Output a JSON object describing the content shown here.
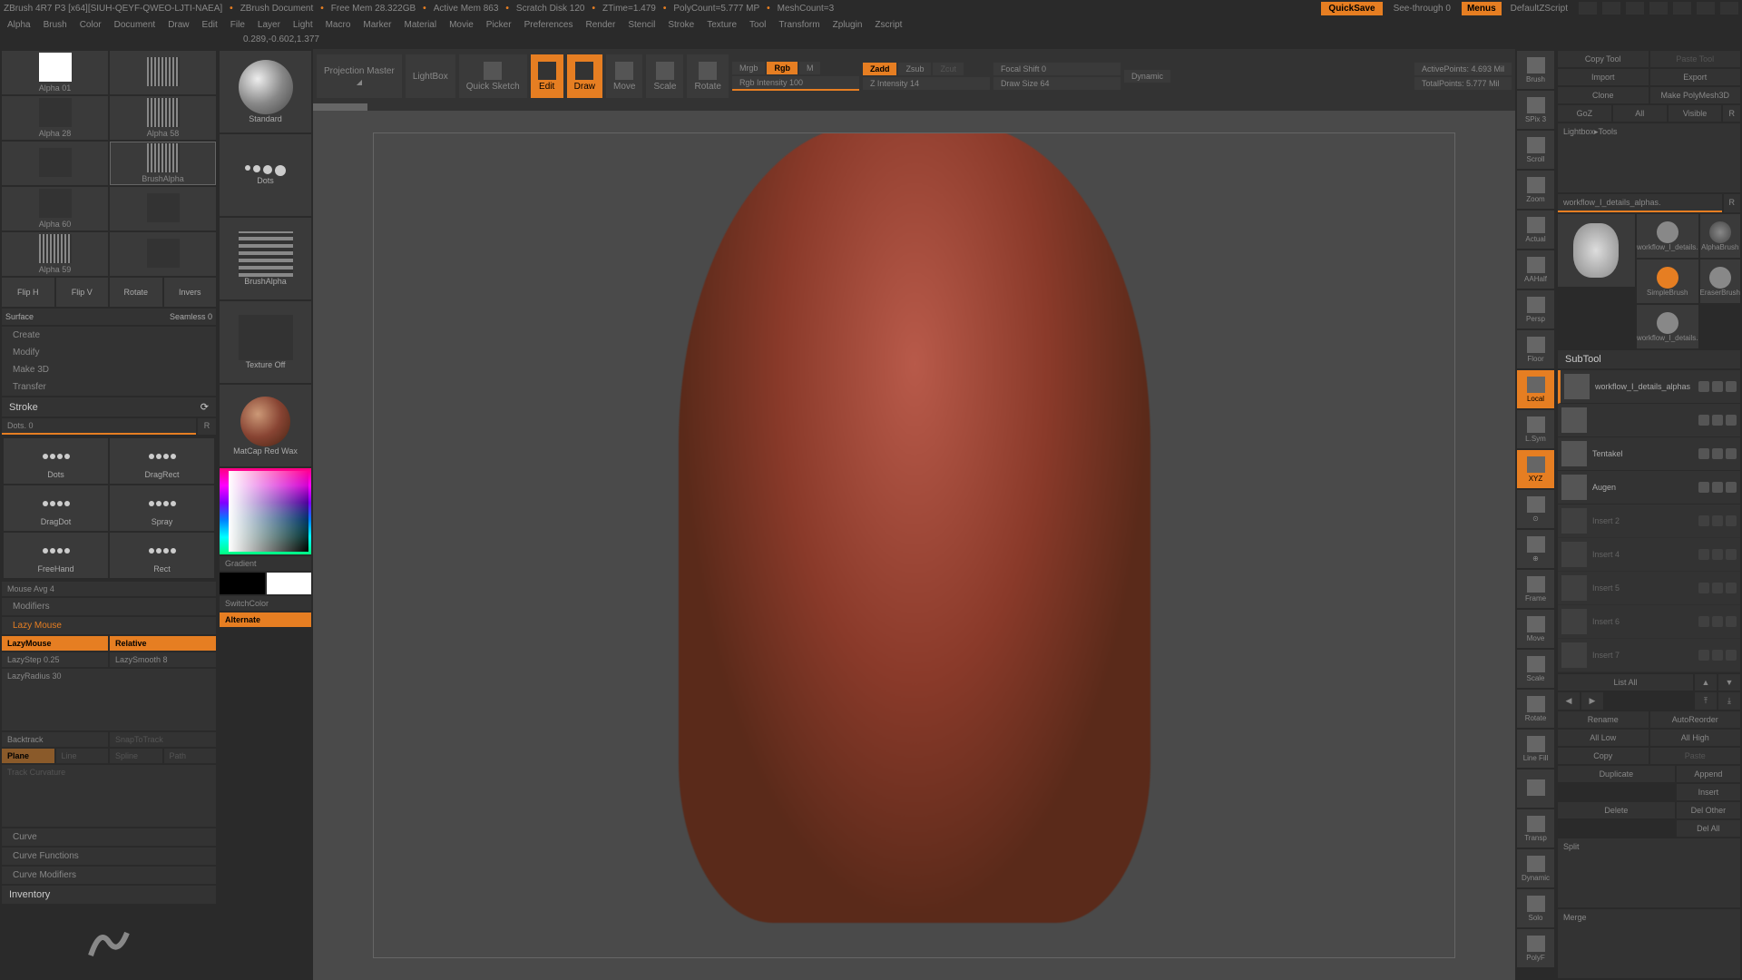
{
  "titlebar": {
    "app": "ZBrush 4R7 P3 [x64][SIUH-QEYF-QWEO-LJTI-NAEA]",
    "doc": "ZBrush Document",
    "freemem": "Free Mem 28.322GB",
    "activemem": "Active Mem 863",
    "scratch": "Scratch Disk 120",
    "ztime": "ZTime=1.479",
    "polycount": "PolyCount=5.777 MP",
    "meshcount": "MeshCount=3",
    "quicksave": "QuickSave",
    "seethrough": "See-through   0",
    "menus": "Menus",
    "script": "DefaultZScript"
  },
  "menubar": [
    "Alpha",
    "Brush",
    "Color",
    "Document",
    "Draw",
    "Edit",
    "File",
    "Layer",
    "Light",
    "Macro",
    "Marker",
    "Material",
    "Movie",
    "Picker",
    "Preferences",
    "Render",
    "Stencil",
    "Stroke",
    "Texture",
    "Tool",
    "Transform",
    "Zplugin",
    "Zscript"
  ],
  "info": "0.289,-0.602,1.377",
  "alphas": [
    {
      "name": "Alpha 01",
      "type": "white"
    },
    {
      "name": "",
      "type": "lines"
    },
    {
      "name": "Alpha 28",
      "type": "blank"
    },
    {
      "name": "Alpha 58",
      "type": "lines"
    },
    {
      "name": "",
      "type": "blank"
    },
    {
      "name": "BrushAlpha",
      "type": "lines"
    },
    {
      "name": "Alpha 60",
      "type": "blank"
    },
    {
      "name": "",
      "type": "blank"
    },
    {
      "name": "Alpha 59",
      "type": "lines"
    },
    {
      "name": "",
      "type": "blank"
    }
  ],
  "tool_small": [
    "Flip H",
    "Flip V",
    "Rotate",
    "Invers"
  ],
  "surface_label": "Surface",
  "seamless": "Seamless 0",
  "create_items": [
    "Create",
    "Modify",
    "Make 3D",
    "Transfer"
  ],
  "stroke_header": "Stroke",
  "stroke_label": "Dots. 0",
  "stroke_r": "R",
  "stroke_types": [
    "Dots",
    "DragRect",
    "DragDot",
    "Spray",
    "FreeHand",
    "Rect"
  ],
  "mouse_avg": "Mouse Avg 4",
  "modifiers_label": "Modifiers",
  "lazy_mouse_label": "Lazy Mouse",
  "lazymouse": "LazyMouse",
  "relative": "Relative",
  "lazystep": "LazyStep 0.25",
  "lazysmooth": "LazySmooth 8",
  "lazyradius": "LazyRadius 30",
  "backtrack": "Backtrack",
  "snaptotrack": "SnapToTrack",
  "bt_modes": [
    "Plane",
    "Line",
    "Spline",
    "Path"
  ],
  "track_curvature": "Track Curvature",
  "curve": "Curve",
  "curve_functions": "Curve Functions",
  "curve_modifiers": "Curve Modifiers",
  "inventory": "Inventory",
  "brush_standard": "Standard",
  "brush_dots": "Dots",
  "brush_alpha": "BrushAlpha",
  "texture_off": "Texture Off",
  "matcap": "MatCap Red Wax",
  "gradient": "Gradient",
  "switchcolor": "SwitchColor",
  "alternate": "Alternate",
  "toolbar": {
    "projection": "Projection Master",
    "lightbox": "LightBox",
    "quicksketch": "Quick Sketch",
    "edit": "Edit",
    "draw": "Draw",
    "move": "Move",
    "scale": "Scale",
    "rotate": "Rotate",
    "mrgb": "Mrgb",
    "rgb": "Rgb",
    "m": "M",
    "rgb_intensity": "Rgb Intensity 100",
    "zadd": "Zadd",
    "zsub": "Zsub",
    "zcut": "Zcut",
    "z_intensity": "Z Intensity 14",
    "focal_shift": "Focal Shift 0",
    "draw_size": "Draw Size 64",
    "dynamic": "Dynamic",
    "activepoints": "ActivePoints: 4.693 Mil",
    "totalpoints": "TotalPoints: 5.777 Mil"
  },
  "right_icons": [
    "Brush",
    "SPix 3",
    "Scroll",
    "Zoom",
    "Actual",
    "AAHalf",
    "Persp",
    "Floor",
    "Local",
    "L.Sym",
    "XYZ",
    "⊙",
    "⊕",
    "Frame",
    "Move",
    "Scale",
    "Rotate",
    "Line Fill",
    "",
    "Transp",
    "Dynamic",
    "Solo",
    "PolyF"
  ],
  "right_panel": {
    "copy_tool": "Copy Tool",
    "paste_tool": "Paste Tool",
    "import": "Import",
    "export": "Export",
    "clone": "Clone",
    "make_polymesh": "Make PolyMesh3D",
    "goz": "GoZ",
    "all": "All",
    "visible": "Visible",
    "r": "R",
    "lightbox_tools": "Lightbox▸Tools",
    "tool_name": "workflow_I_details_alphas.",
    "tools": [
      "workflow_I_details.",
      "AlphaBrush",
      "SimpleBrush",
      "EraserBrush",
      "workflow_I_details."
    ],
    "subtool": "SubTool",
    "subtools": [
      {
        "name": "workflow_I_details_alphas",
        "active": true
      },
      {
        "name": "",
        "active": false
      },
      {
        "name": "Tentakel",
        "active": false
      },
      {
        "name": "Augen",
        "active": false
      },
      {
        "name": "Insert 2",
        "active": false,
        "dim": true
      },
      {
        "name": "Insert 4",
        "active": false,
        "dim": true
      },
      {
        "name": "Insert 5",
        "active": false,
        "dim": true
      },
      {
        "name": "Insert 6",
        "active": false,
        "dim": true
      },
      {
        "name": "Insert 7",
        "active": false,
        "dim": true
      }
    ],
    "list_all": "List All",
    "rename": "Rename",
    "autoreorder": "AutoReorder",
    "all_low": "All Low",
    "all_high": "All High",
    "copy": "Copy",
    "paste": "Paste",
    "duplicate": "Duplicate",
    "append": "Append",
    "insert": "Insert",
    "delete": "Delete",
    "del_other": "Del Other",
    "del_all": "Del All",
    "split": "Split",
    "merge": "Merge"
  }
}
